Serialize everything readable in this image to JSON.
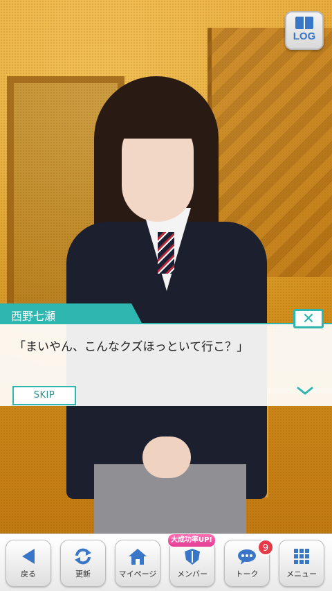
{
  "log": {
    "label": "LOG"
  },
  "dialog": {
    "speaker": "西野七瀬",
    "message": "「まいやん、こんなクズほっといて行こ？」",
    "skip_label": "SKIP",
    "close_symbol": "✕"
  },
  "nav": {
    "items": [
      {
        "label": "戻る",
        "icon": "back-arrow-icon"
      },
      {
        "label": "更新",
        "icon": "refresh-icon"
      },
      {
        "label": "マイページ",
        "icon": "home-icon"
      },
      {
        "label": "メンバー",
        "icon": "member-shield-icon"
      },
      {
        "label": "トーク",
        "icon": "chat-bubble-icon"
      },
      {
        "label": "メニュー",
        "icon": "grid-menu-icon"
      }
    ],
    "talk_badge": "9",
    "promo_label": "大成功率UP!"
  },
  "colors": {
    "accent": "#2eb7b1",
    "badge": "#e53b49",
    "icon_blue": "#3a76c8"
  }
}
